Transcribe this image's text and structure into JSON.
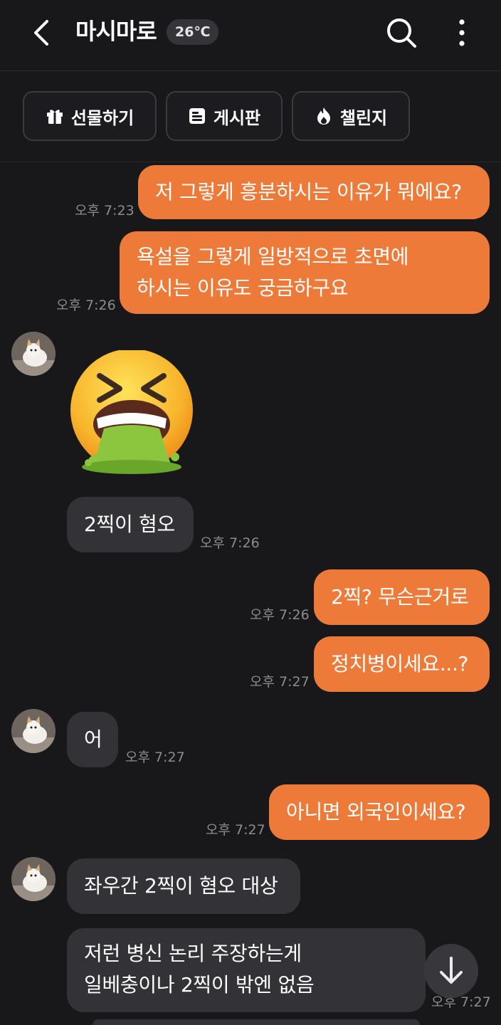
{
  "header": {
    "title": "마시마로",
    "temperature": "26℃",
    "icons": [
      "back-arrow-icon",
      "search-icon",
      "more-vertical-icon"
    ]
  },
  "actions": [
    {
      "label": "선물하기",
      "icon": "gift-icon"
    },
    {
      "label": "게시판",
      "icon": "board-icon"
    },
    {
      "label": "챌린지",
      "icon": "flame-icon"
    }
  ],
  "messages": [
    {
      "sender": "me",
      "text": "저 그렇게 흥분하시는 이유가 뭐에요?",
      "time": "오후 7:23"
    },
    {
      "sender": "me",
      "lines": [
        "욕설을 그렇게 일방적으로 초면에",
        "하시는 이유도 궁금하구요"
      ],
      "time": "오후 7:26"
    },
    {
      "sender": "them",
      "type": "emoji",
      "emoji": "vomiting-face-emoji"
    },
    {
      "sender": "them",
      "text": "2찍이 혐오",
      "time": "오후 7:26"
    },
    {
      "sender": "me",
      "text": "2찍? 무슨근거로",
      "time": "오후 7:26"
    },
    {
      "sender": "me",
      "text": "정치병이세요...?",
      "time": "오후 7:27"
    },
    {
      "sender": "them",
      "text": "어",
      "time": "오후 7:27"
    },
    {
      "sender": "me",
      "text": "아니면 외국인이세요?",
      "time": "오후 7:27"
    },
    {
      "sender": "them",
      "text": "좌우간 2찍이 혐오 대상"
    },
    {
      "sender": "them",
      "lines": [
        "저런 병신 논리 주장하는게",
        "일베충이나 2찍이 밖엔 없음"
      ],
      "time": "오후 7:27"
    }
  ],
  "colors": {
    "background": "#18181b",
    "my_bubble": "#ee7a3a",
    "their_bubble": "#333337"
  }
}
